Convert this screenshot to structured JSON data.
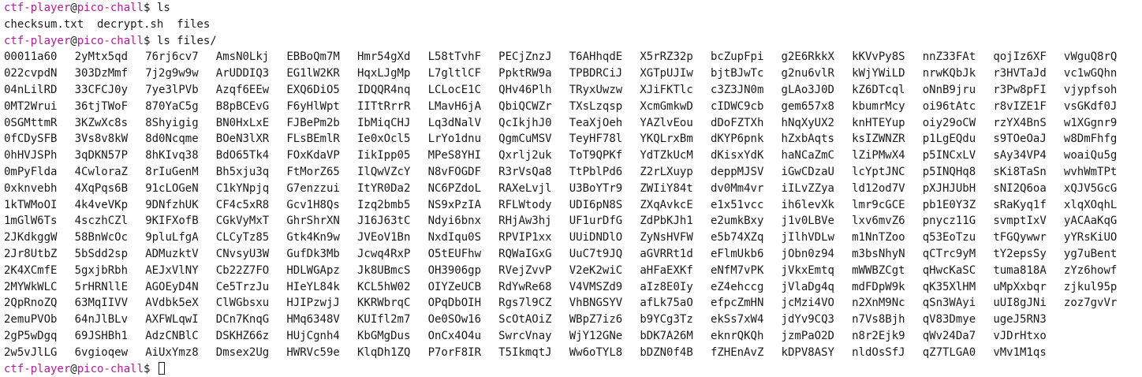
{
  "prompt": {
    "user": "ctf-player",
    "at": "@",
    "host": "pico-chall",
    "symbol": "$"
  },
  "cmd1": " ls",
  "ls_output": "checksum.txt  decrypt.sh  files",
  "cmd2": " ls files/",
  "files": [
    "00011a60",
    "2yMtx5qd",
    "76rj6cv7",
    "AmsN0Lkj",
    "EBBoQm7M",
    "Hmr54gXd",
    "L58tTvhF",
    "PECjZnzJ",
    "T6AHhqdE",
    "X5rRZ32p",
    "bcZupFpi",
    "g2E6RkkX",
    "kKVvPy8S",
    "nnZ33FAt",
    "qojIz6XF",
    "vWguQ8rQ",
    "022cvpdN",
    "303DzMmf",
    "7j2g9w9w",
    "ArUDDIQ3",
    "EG1lW2KR",
    "HqxLJgMp",
    "L7gltlCF",
    "PpktRW9a",
    "TPBDRCiJ",
    "XGTpUJIw",
    "bjtBJwTc",
    "g2nu6vlR",
    "kWjYWiLD",
    "nrwKQbJk",
    "r3HVTaJd",
    "vc1wGQhn",
    "04nLilRD",
    "33CFCJ0y",
    "7ye3lPVb",
    "Azqf6EEw",
    "EXQ6DiO5",
    "IDQQR4nq",
    "LCLocE1C",
    "QHv46Plh",
    "TRyxUwzw",
    "XJiFKTlc",
    "c3Z3JN0m",
    "gLAo3J0D",
    "kZ6DTcql",
    "oNnB9jru",
    "r3Pw8pFI",
    "vjypfsoh",
    "0MT2Wrui",
    "36tjTWoF",
    "870YaC5g",
    "B8pBCEvG",
    "F6yHlWpt",
    "IITtRrrR",
    "LMavH6jA",
    "QbiQCWZr",
    "TXsLzqsp",
    "XcmGmkwD",
    "cIDWC9cb",
    "gem657x8",
    "kbumrMcy",
    "oi96tAtc",
    "r8vIZE1F",
    "vsGKdf0J",
    "0SGMttmR",
    "3KZwXc8s",
    "8Shyigig",
    "BN0HxLxE",
    "FJBePm2b",
    "IbMiqCHJ",
    "Lq3dNalV",
    "QcIkjhJ0",
    "TeaXjOeh",
    "YAZlvEou",
    "dDoFZTXh",
    "hNqXyUX2",
    "knHTEYup",
    "oiy29oCW",
    "rzYX4BnS",
    "w1XGgnr9",
    "0fCDySFB",
    "3Vs8v8kW",
    "8d0Ncqme",
    "BOeN3lXR",
    "FLsBEmlR",
    "Ie0xOcl5",
    "LrYo1dnu",
    "QgmCuMSV",
    "TeyHF78l",
    "YKQLrxBm",
    "dKYP6pnk",
    "hZxbAqts",
    "ksIZWNZR",
    "p1LgEQdu",
    "s9TOeOaJ",
    "w8DmFhfg",
    "0hHVJSPh",
    "3qDKN57P",
    "8hKIvq38",
    "BdO65Tk4",
    "FOxKdaVP",
    "IikIpp05",
    "MPeS8YHI",
    "Qxrlj2uk",
    "ToT9QPKf",
    "YdTZkUcM",
    "dKisxYdK",
    "haNCaZmC",
    "lZiPMwX4",
    "p5INCxLV",
    "sAy34VP4",
    "woaiQu5g",
    "0mPyFlda",
    "4CwloraZ",
    "8rIuGenM",
    "Bh5xju3q",
    "FtMorZ65",
    "IlQwVZcY",
    "N8vFOGDF",
    "R3rVsQa8",
    "TtPblPd6",
    "Z2rLXuyp",
    "deppMJSV",
    "iGwCDzaU",
    "lcYptJNC",
    "p5INQHq8",
    "sKi8TaSn",
    "wvhWmTPt",
    "0xknvebh",
    "4XqPqs6B",
    "91cLOGeN",
    "C1kYNpjq",
    "G7enzzui",
    "ItYR0Da2",
    "NC6PZdoL",
    "RAXeLvjl",
    "U3BoYTr9",
    "ZWIiY84t",
    "dv0Mm4vr",
    "iILvZZya",
    "ld12od7V",
    "pXJHJUbH",
    "sNI2Q6oa",
    "xQJV5GcG",
    "1kTWMoOI",
    "4k4veVKp",
    "9DNfzhUK",
    "CF4c5xR8",
    "Gcv1H8Qs",
    "Izq2bmb5",
    "NS9xPzIA",
    "RFLWtody",
    "UDI6pN8S",
    "ZXqAvkcE",
    "e1x51vcc",
    "ih6levXk",
    "lmr9cGCE",
    "pb1E0Y3Z",
    "sRaKyq1f",
    "xlqXOqhL",
    "1mGlW6Ts",
    "4sczhCZl",
    "9KIFXofB",
    "CGkVyMxT",
    "GhrShrXN",
    "J16J63tC",
    "Ndyi6bnx",
    "RHjAw3hj",
    "UF1urDfG",
    "ZdPbKJh1",
    "e2umkBxy",
    "j1v0LBVe",
    "lxv6mvZ6",
    "pnycz11G",
    "svmptIxV",
    "yACAaKqG",
    "2JKdkggW",
    "58BnWcOc",
    "9pluLfgA",
    "CLCyTz85",
    "Gtk4Kn9w",
    "JVEoV1Bn",
    "NxdIqu0S",
    "RPVIP1xx",
    "UUiDNDlO",
    "ZyNsHVFW",
    "e5b74XZq",
    "jIlhVDLw",
    "m1NnTZoo",
    "q53EoTzu",
    "tFGQywwr",
    "yYRsKiUO",
    "2Jr8UtbZ",
    "5bSdd2sp",
    "ADMuzktV",
    "CNvsyU3W",
    "GufDk3Mb",
    "Jcwq4RxP",
    "O5tEUFhw",
    "RQWaIGxG",
    "UuC7t9JQ",
    "aGVRRt1d",
    "eFlmUkb6",
    "jObn0z94",
    "m3bsNhyN",
    "qCTrc9yM",
    "tY2epsSy",
    "yg7uBent",
    "2K4XCmfE",
    "5gxjbRbh",
    "AEJxVlNY",
    "Cb22Z7FO",
    "HDLWGApz",
    "Jk8UBmcS",
    "OH3906gp",
    "RVejZvvP",
    "V2eK2wiC",
    "aHFaEXKf",
    "eNfM7vPK",
    "jVkxEmtq",
    "mWWBZCgt",
    "qHwcKaSC",
    "tuma818A",
    "zYz6howf",
    "2MYWkWLC",
    "5rHRNllE",
    "AGOEyD4N",
    "Ce5TrzJu",
    "HIeYL84k",
    "KCL5hW02",
    "OIYZeUCB",
    "RdYwRe68",
    "V4VMSZd9",
    "aIz8E0Iy",
    "eZ4ehccg",
    "jVlaDg4q",
    "mdFDpW9k",
    "qK35XlHM",
    "uMpXxbqr",
    "zjkul95p",
    "2QpRnoZQ",
    "63MqIIVV",
    "AVdbk5eX",
    "ClWGbsxu",
    "HJIPzwjJ",
    "KKRWbrqC",
    "OPqDbOIH",
    "Rgs7l9CZ",
    "VhBNGSYV",
    "afLk75aO",
    "efpcZmHN",
    "jcMzi4VO",
    "n2XnM9Nc",
    "qSn3WAyi",
    "uUI8gJNi",
    "zoz7gvVr",
    "2emuPVOb",
    "64nJlBLv",
    "AXFWLqwI",
    "DCn7KnqG",
    "HMq6348V",
    "KUIfl2m7",
    "Oe0SOw16",
    "ScOtAOiZ",
    "WBpZ7iz6",
    "b9YCg3Tz",
    "ekSs7xW4",
    "jdYv9CQ3",
    "n7Vs8Bjh",
    "qV83Dmye",
    "ugeJ5RN3",
    "",
    "2gP5wDgq",
    "69JSHBh1",
    "AdzCNBlC",
    "DSKHZ66z",
    "HUjCgnh4",
    "KbGMgDus",
    "OnCx4O4u",
    "SwrcVnay",
    "WjY12GNe",
    "bDK7A26M",
    "eknrQKQh",
    "jzmPaO2D",
    "n8r2Ejk9",
    "qWv24Da7",
    "vJDrHtxo",
    "",
    "2w5vJlLG",
    "6vgioqew",
    "AiUxYmz8",
    "Dmsex2Ug",
    "HWRVc59e",
    "KlqDh1ZQ",
    "P7orF8IR",
    "T5IkmqtJ",
    "Ww6oTYL8",
    "bDZN0f4B",
    "fZHEnAvZ",
    "kDPV8ASY",
    "nldOsSfJ",
    "qZ7TLGA0",
    "vMv1M1qs",
    ""
  ]
}
